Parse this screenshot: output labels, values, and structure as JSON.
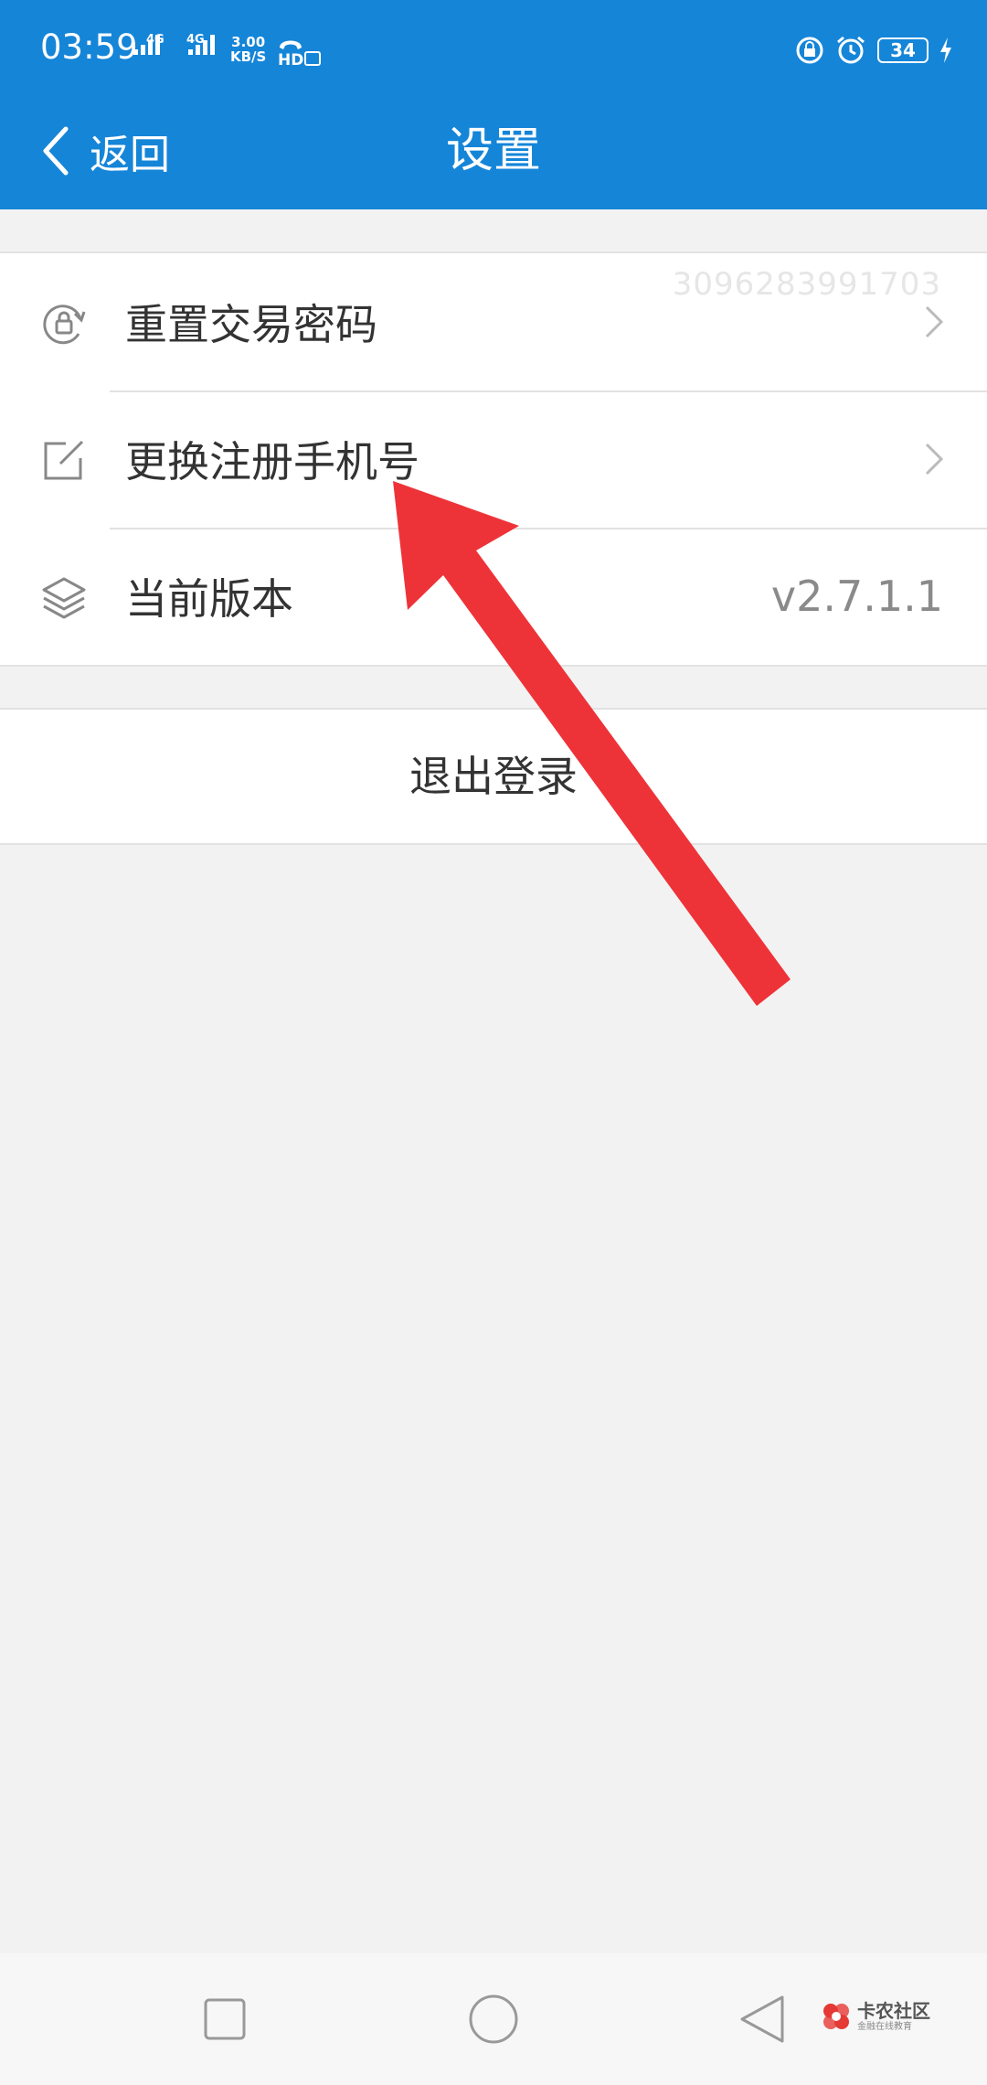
{
  "status_bar": {
    "time": "03:59",
    "signal1_label": "4G",
    "signal2_label": "4G",
    "speed_value": "3.00",
    "speed_unit": "KB/S",
    "hd_label": "HD",
    "battery_level": "34"
  },
  "title_bar": {
    "back_label": "返回",
    "title": "设置"
  },
  "settings": {
    "items": [
      {
        "label": "重置交易密码",
        "icon": "lock-refresh-icon",
        "has_chevron": true,
        "overlay_text": "3096283991703"
      },
      {
        "label": "更换注册手机号",
        "icon": "edit-icon",
        "has_chevron": true
      },
      {
        "label": "当前版本",
        "icon": "layers-icon",
        "value": "v2.7.1.1"
      }
    ]
  },
  "logout": {
    "label": "退出登录"
  },
  "annotation": {
    "arrow_color": "#ee3338"
  },
  "watermark": {
    "main": "卡农社区",
    "sub": "金融在线教育"
  },
  "colors": {
    "header": "#1585d8",
    "background": "#f2f2f2"
  }
}
